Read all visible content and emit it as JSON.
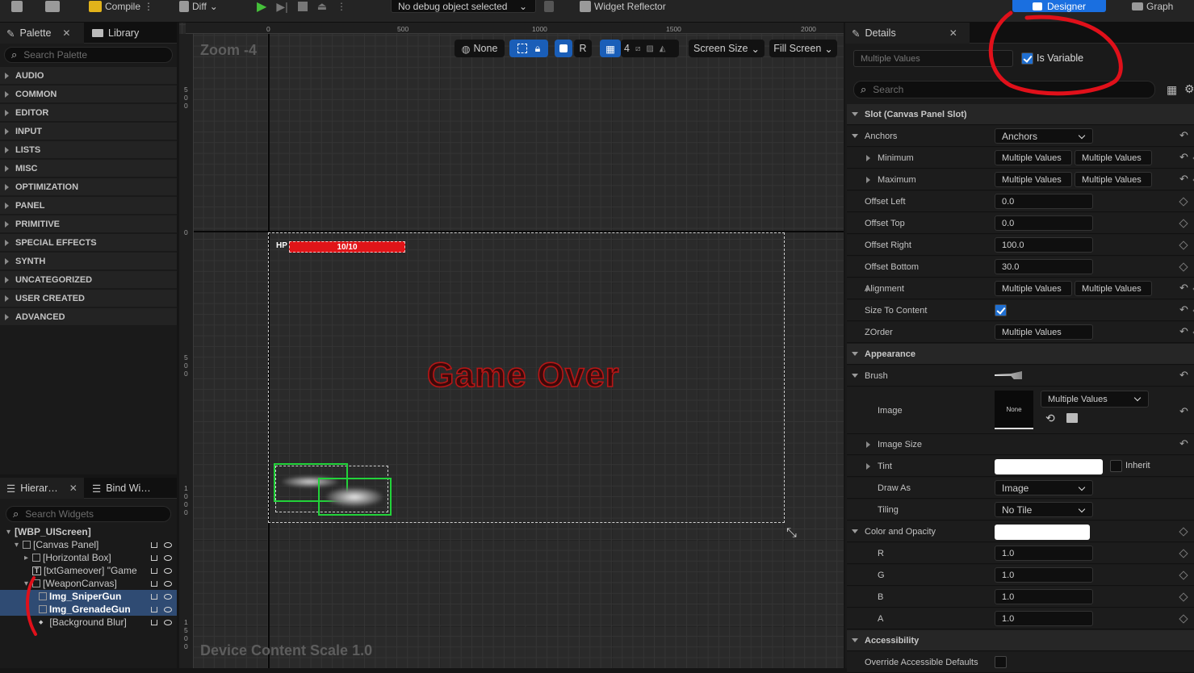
{
  "toolbar": {
    "compile_label": "Compile",
    "diff_label": "Diff",
    "debug_select": "No debug object selected",
    "widget_reflector": "Widget Reflector",
    "designer_label": "Designer",
    "graph_label": "Graph"
  },
  "palette": {
    "tab_palette": "Palette",
    "tab_library": "Library",
    "search_placeholder": "Search Palette",
    "categories": [
      "AUDIO",
      "COMMON",
      "EDITOR",
      "INPUT",
      "LISTS",
      "MISC",
      "OPTIMIZATION",
      "PANEL",
      "PRIMITIVE",
      "SPECIAL EFFECTS",
      "SYNTH",
      "UNCATEGORIZED",
      "USER CREATED",
      "ADVANCED"
    ]
  },
  "hierarchy": {
    "tab_hierarchy": "Hierar…",
    "tab_bind": "Bind Wi…",
    "search_placeholder": "Search Widgets",
    "items": [
      {
        "label": "[WBP_UIScreen]"
      },
      {
        "label": "[Canvas Panel]"
      },
      {
        "label": "[Horizontal Box]"
      },
      {
        "label": "[txtGameover] \"Game"
      },
      {
        "label": "[WeaponCanvas]"
      },
      {
        "label": "Img_SniperGun"
      },
      {
        "label": "Img_GrenadeGun"
      },
      {
        "label": "[Background Blur]"
      }
    ]
  },
  "canvas": {
    "zoom_label": "Zoom -4",
    "device_scale": "Device Content Scale 1.0",
    "ruler_top": [
      "0",
      "500",
      "1000",
      "1500",
      "2000"
    ],
    "ruler_left": [
      "5\n0\n0",
      "0",
      "5\n0\n0",
      "1\n0\n0\n0",
      "1\n5\n0\n0"
    ],
    "none_label": "None",
    "r_label": "R",
    "grid_count": "4",
    "screen_size": "Screen Size",
    "fill_screen": "Fill Screen",
    "hp_label": "HP",
    "hp_value": "10/10",
    "gameover_text": "Game Over"
  },
  "details": {
    "tab_label": "Details",
    "name_placeholder": "Multiple Values",
    "is_variable_label": "Is Variable",
    "is_variable": true,
    "search_placeholder": "Search",
    "slot_header": "Slot (Canvas Panel Slot)",
    "anchors_label": "Anchors",
    "anchors_value": "Anchors",
    "minimum_label": "Minimum",
    "maximum_label": "Maximum",
    "multiple_values": "Multiple Values",
    "offset_left_label": "Offset Left",
    "offset_left": "0.0",
    "offset_top_label": "Offset Top",
    "offset_top": "0.0",
    "offset_right_label": "Offset Right",
    "offset_right": "100.0",
    "offset_bottom_label": "Offset Bottom",
    "offset_bottom": "30.0",
    "alignment_label": "Alignment",
    "size_to_content_label": "Size To Content",
    "zorder_label": "ZOrder",
    "appearance_header": "Appearance",
    "brush_label": "Brush",
    "image_label": "Image",
    "image_none": "None",
    "image_size_label": "Image Size",
    "tint_label": "Tint",
    "inherit_label": "Inherit",
    "draw_as_label": "Draw As",
    "draw_as_value": "Image",
    "tiling_label": "Tiling",
    "tiling_value": "No Tile",
    "color_opacity_label": "Color and Opacity",
    "r_label": "R",
    "r_value": "1.0",
    "g_label": "G",
    "g_value": "1.0",
    "b_label": "B",
    "b_value": "1.0",
    "a_label": "A",
    "a_value": "1.0",
    "accessibility_header": "Accessibility",
    "override_label": "Override Accessible Defaults"
  },
  "colors": {
    "accent_blue": "#1a5eb8",
    "hp_red": "#e01418",
    "selection": "#2f4b73",
    "annotation_red": "#e0101a",
    "gun_outline": "#22d33a"
  }
}
